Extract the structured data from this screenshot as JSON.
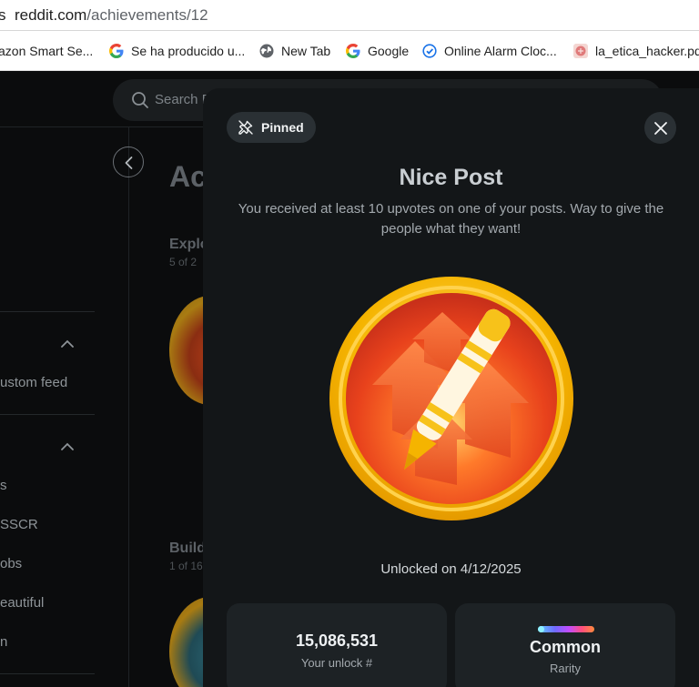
{
  "browser": {
    "url_host": "reddit.com",
    "url_path": "/achievements/12",
    "bookmarks": [
      {
        "label": "azon Smart Se...",
        "icon": "amazon-icon"
      },
      {
        "label": "Se ha producido u...",
        "icon": "google-icon"
      },
      {
        "label": "New Tab",
        "icon": "globe-icon"
      },
      {
        "label": "Google",
        "icon": "google-icon"
      },
      {
        "label": "Online Alarm Cloc...",
        "icon": "alarm-check-icon"
      },
      {
        "label": "la_etica_hacker.pdf",
        "icon": "brain-icon"
      }
    ]
  },
  "background": {
    "search_placeholder": "Search R",
    "title": "Ac",
    "sections": [
      {
        "title": "Explo",
        "subtitle": "5 of 2"
      },
      {
        "title": "Build",
        "subtitle": "1 of 16"
      }
    ],
    "sidebar": [
      "ustom feed",
      "s",
      "SSCR",
      "obs",
      "eautiful",
      "n"
    ]
  },
  "modal": {
    "pinned_label": "Pinned",
    "title": "Nice Post",
    "description": "You received at least 10 upvotes on one of your posts. Way to give the people what they want!",
    "unlocked_text": "Unlocked on 4/12/2025",
    "stats": {
      "unlock_number": "15,086,531",
      "unlock_label": "Your unlock #",
      "rarity_value": "Common",
      "rarity_label": "Rarity"
    }
  },
  "colors": {
    "modal_bg": "#131618",
    "badge_gold": "#f5b400",
    "badge_orange": "#f25c1f"
  }
}
